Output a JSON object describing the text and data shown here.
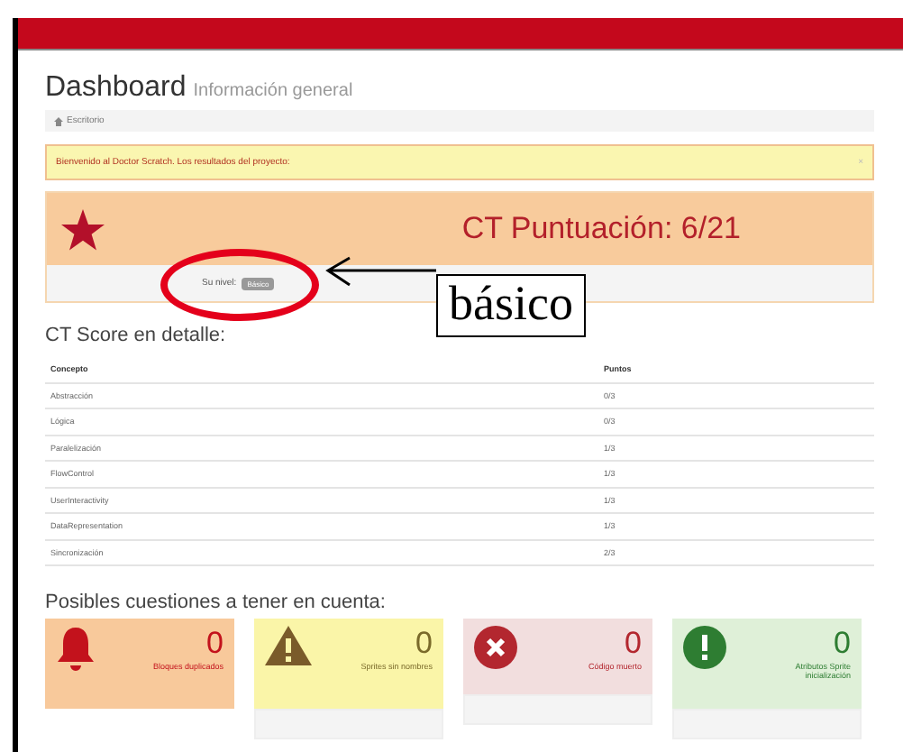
{
  "header": {
    "title": "Dashboard",
    "subtitle": "Información general"
  },
  "breadcrumb": "Escritorio",
  "alert": {
    "text": "Bienvenido al Doctor Scratch. Los resultados del proyecto:",
    "close": "×"
  },
  "score": {
    "title": "CT Puntuación: 6/21",
    "level_label": "Su nivel:",
    "level_badge": "Básico"
  },
  "annotation": {
    "text": "básico"
  },
  "detail": {
    "heading": "CT Score en detalle:",
    "columns": [
      "Concepto",
      "Puntos"
    ],
    "rows": [
      [
        "Abstracción",
        "0/3"
      ],
      [
        "Lógica",
        "0/3"
      ],
      [
        "Paralelización",
        "1/3"
      ],
      [
        "FlowControl",
        "1/3"
      ],
      [
        "UserInteractivity",
        "1/3"
      ],
      [
        "DataRepresentation",
        "1/3"
      ],
      [
        "Sincronización",
        "2/3"
      ]
    ]
  },
  "issues": {
    "heading": "Posibles cuestiones a tener en cuenta:",
    "cards": [
      {
        "kind": "bell",
        "count": "0",
        "label": "Bloques duplicados",
        "color": "#f8c99b"
      },
      {
        "kind": "warning",
        "count": "0",
        "label": "Sprites sin nombres",
        "color": "#faf5a8"
      },
      {
        "kind": "error",
        "count": "0",
        "label": "Código muerto",
        "color": "#f2dede"
      },
      {
        "kind": "info",
        "count": "0",
        "label": "Atributos Sprite inicialización",
        "color": "#dff0d8"
      }
    ]
  }
}
